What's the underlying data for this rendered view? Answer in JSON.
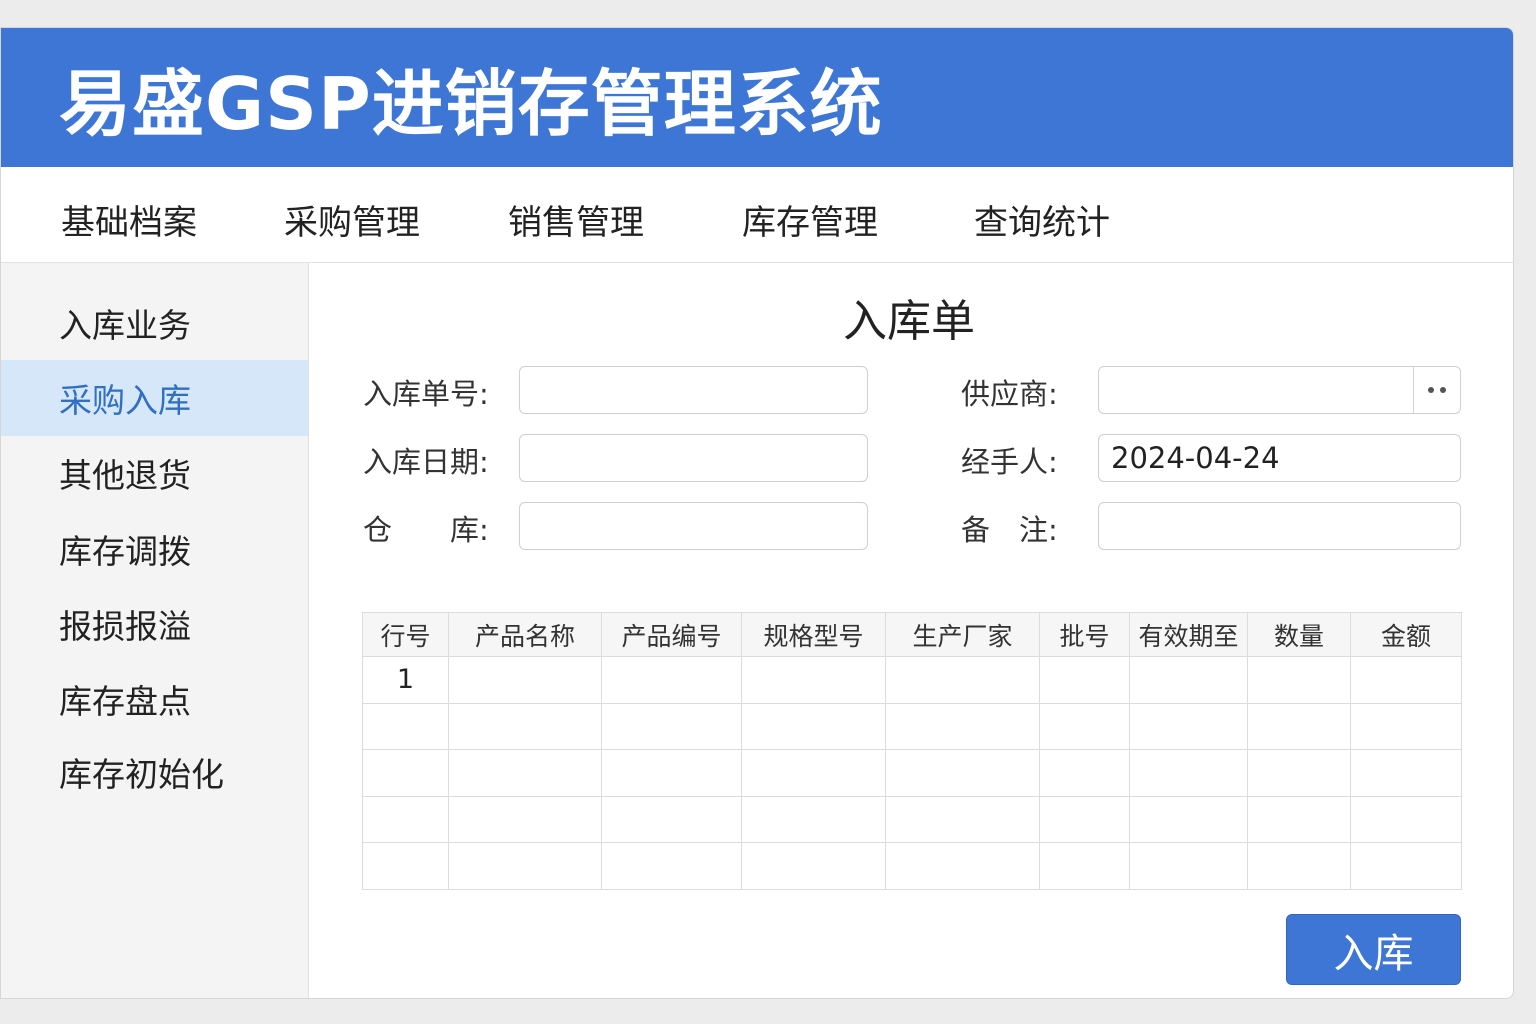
{
  "app": {
    "title": "易盛GSP进销存管理系统"
  },
  "menu": [
    {
      "label": "基础档案"
    },
    {
      "label": "采购管理"
    },
    {
      "label": "销售管理"
    },
    {
      "label": "库存管理"
    },
    {
      "label": "查询统计"
    }
  ],
  "sidebar": {
    "items": [
      {
        "label": "入库业务"
      },
      {
        "label": "采购入库",
        "active": true
      },
      {
        "label": "其他退货"
      },
      {
        "label": "库存调拨"
      },
      {
        "label": "报损报溢"
      },
      {
        "label": "库存盘点"
      },
      {
        "label": "库存初始化"
      }
    ]
  },
  "form": {
    "title": "入库单",
    "fields": {
      "order_no": {
        "label": "入库单号:",
        "value": ""
      },
      "supplier": {
        "label": "供应商:",
        "value": ""
      },
      "date": {
        "label": "入库日期:",
        "value": ""
      },
      "handler": {
        "label": "经手人:",
        "value": "2024-04-24"
      },
      "warehouse": {
        "label": "仓　　库:",
        "value": ""
      },
      "remark": {
        "label": "备　注:",
        "value": ""
      }
    }
  },
  "table": {
    "columns": [
      "行号",
      "产品名称",
      "产品编号",
      "规格型号",
      "生产厂家",
      "批号",
      "有效期至",
      "数量",
      "金额"
    ],
    "rows": [
      [
        "1",
        "",
        "",
        "",
        "",
        "",
        "",
        "",
        ""
      ],
      [
        "",
        "",
        "",
        "",
        "",
        "",
        "",
        "",
        ""
      ],
      [
        "",
        "",
        "",
        "",
        "",
        "",
        "",
        "",
        ""
      ],
      [
        "",
        "",
        "",
        "",
        "",
        "",
        "",
        "",
        ""
      ],
      [
        "",
        "",
        "",
        "",
        "",
        "",
        "",
        "",
        ""
      ]
    ]
  },
  "actions": {
    "submit_label": "入库"
  },
  "colors": {
    "primary": "#3d76d4",
    "active_bg": "#d5e7f8",
    "active_text": "#2f6fc4"
  }
}
